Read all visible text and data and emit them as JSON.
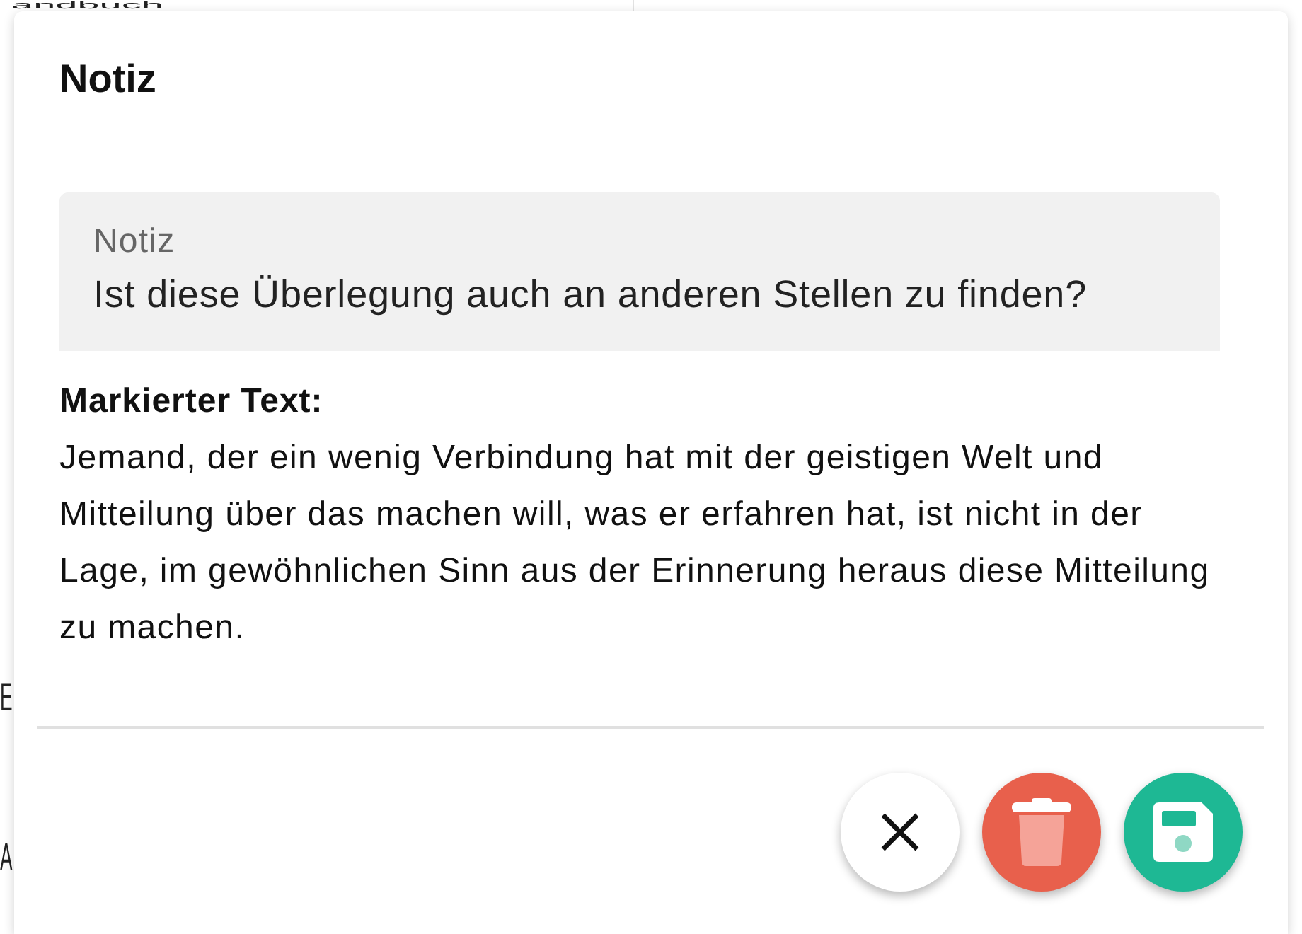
{
  "background_page": {
    "heading_fragment": "andbuch",
    "line_starts": [
      "E",
      "A"
    ]
  },
  "dialog": {
    "title": "Notiz",
    "note_field": {
      "label": "Notiz",
      "value": "Ist diese Überlegung auch an anderen Stellen zu finden?"
    },
    "marked_text": {
      "label": "Markierter Text:",
      "text": "Jemand, der ein wenig Verbindung hat mit der geistigen Welt und Mitteilung über das machen will, was er erfahren hat, ist nicht in der Lage, im gewöhnlichen Sinn aus der Erinnerung heraus diese Mitteilung zu machen."
    },
    "actions": [
      {
        "kind": "close"
      },
      {
        "kind": "delete"
      },
      {
        "kind": "save"
      }
    ]
  }
}
